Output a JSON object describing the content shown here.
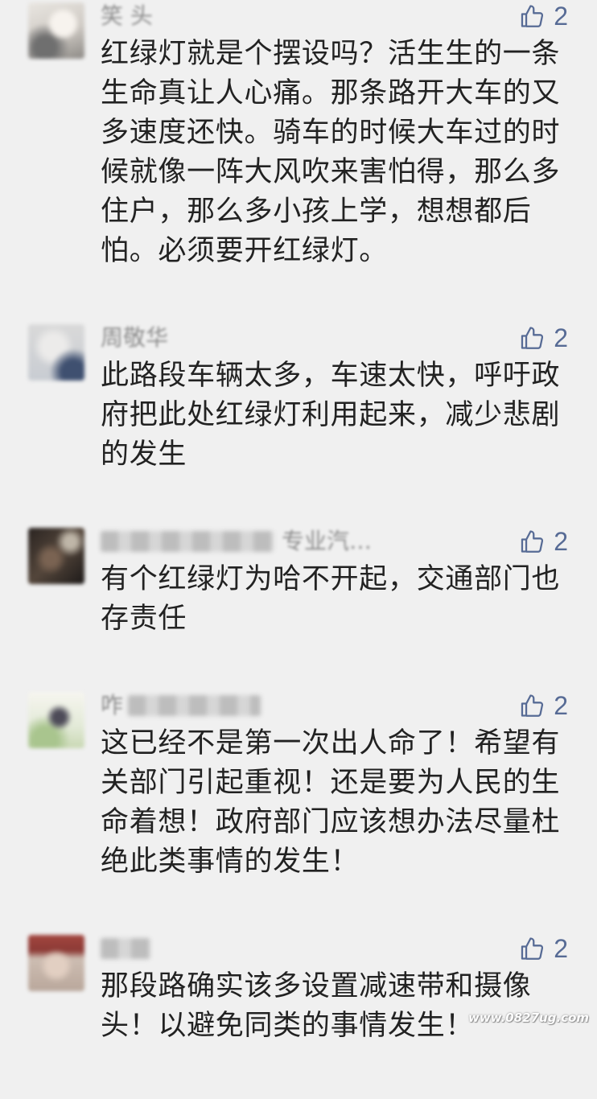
{
  "comments": [
    {
      "username": "笑 头",
      "likes": "2",
      "lines": [
        "红绿灯就是个摆设吗？活生生的一条",
        "生命真让人心痛。那条路开大车的又",
        "多速度还快。骑车的时候大车过的时",
        "候就像一阵大风吹来害怕得，那么多",
        "住户，那么多小孩上学，想想都后",
        "怕。必须要开红绿灯。"
      ]
    },
    {
      "username": "周敬华",
      "likes": "2",
      "lines": [
        "此路段车辆太多，车速太快，呼吁政",
        "府把此处红绿灯利用起来，减少悲剧",
        "的发生"
      ]
    },
    {
      "username": "专业汽…",
      "likes": "2",
      "lines": [
        "有个红绿灯为哈不开起，交通部门也",
        "存责任"
      ]
    },
    {
      "username": "咋",
      "likes": "2",
      "lines": [
        "这已经不是第一次出人命了！希望有",
        "关部门引起重视！还是要为人民的生",
        "命着想！政府部门应该想办法尽量杜",
        "绝此类事情的发生！"
      ]
    },
    {
      "likes": "2",
      "lines": [
        "那段路确实该多设置减速带和摄像",
        "头！以避免同类的事情发生！"
      ]
    }
  ],
  "icons": {
    "like": "thumbs-up-icon",
    "avatar": "blurred-avatar"
  },
  "colors": {
    "background": "#f0f0f0",
    "like": "#576b95",
    "text": "#222222",
    "username": "#8c8c8c"
  },
  "watermark": "www.0827ug.com"
}
